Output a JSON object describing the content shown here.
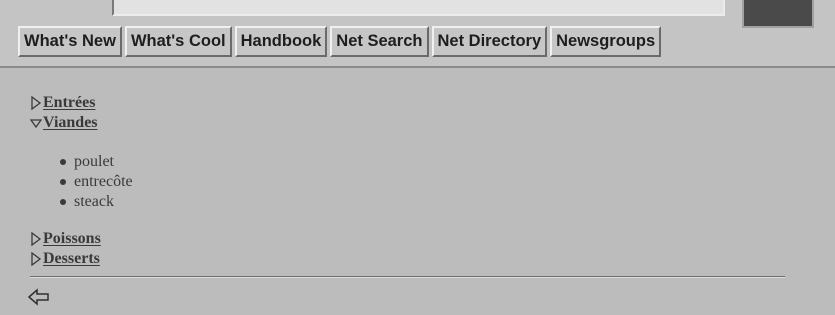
{
  "toolbar": {
    "location_value": "",
    "buttons": [
      {
        "label": "What's New"
      },
      {
        "label": "What's Cool"
      },
      {
        "label": "Handbook"
      },
      {
        "label": "Net Search"
      },
      {
        "label": "Net Directory"
      },
      {
        "label": "Newsgroups"
      }
    ]
  },
  "menu": {
    "items": [
      {
        "label": "Entrées",
        "expanded": false
      },
      {
        "label": "Viandes",
        "expanded": true
      },
      {
        "label": "Poissons",
        "expanded": false
      },
      {
        "label": "Desserts",
        "expanded": false
      }
    ],
    "viandes_children": [
      {
        "label": "poulet"
      },
      {
        "label": "entrecôte"
      },
      {
        "label": "steack"
      }
    ]
  },
  "icons": {
    "collapsed": "triangle-right-icon",
    "expanded": "triangle-down-icon",
    "back": "back-arrow-icon"
  },
  "colors": {
    "background": "#bcbcbc",
    "text": "#3a3a3a",
    "button_text": "#1e1e1e"
  }
}
